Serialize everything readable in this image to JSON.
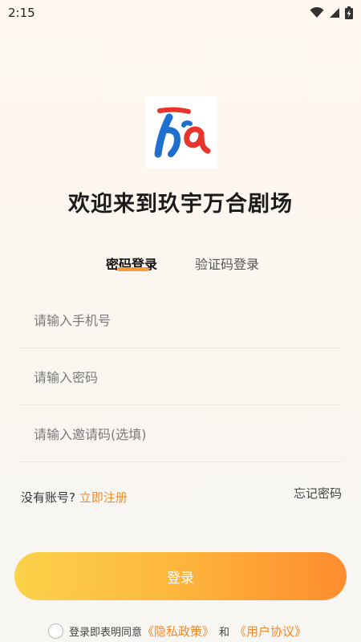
{
  "status_bar": {
    "time": "2:15",
    "wifi_icon": "wifi-icon",
    "signal_icon": "cell-signal-icon",
    "battery_icon": "battery-charging-icon"
  },
  "app": {
    "logo_icon": "app-logo",
    "title": "欢迎来到玖宇万合剧场",
    "brand_colors": {
      "blue": "#1f6fd1",
      "red": "#e8342a",
      "accent": "#f79a3a"
    }
  },
  "tabs": [
    {
      "label": "密码登录",
      "active": true
    },
    {
      "label": "验证码登录",
      "active": false
    }
  ],
  "form": {
    "phone_placeholder": "请输入手机号",
    "password_placeholder": "请输入密码",
    "invite_placeholder": "请输入邀请码(选填)"
  },
  "register": {
    "prompt": "没有账号?",
    "link": "立即注册"
  },
  "forgot_label": "忘记密码",
  "login_label": "登录",
  "agreement": {
    "text": "登录即表明同意",
    "privacy_link": "《隐私政策》",
    "and": "和",
    "terms_link": "《用户协议》",
    "checked": false
  }
}
